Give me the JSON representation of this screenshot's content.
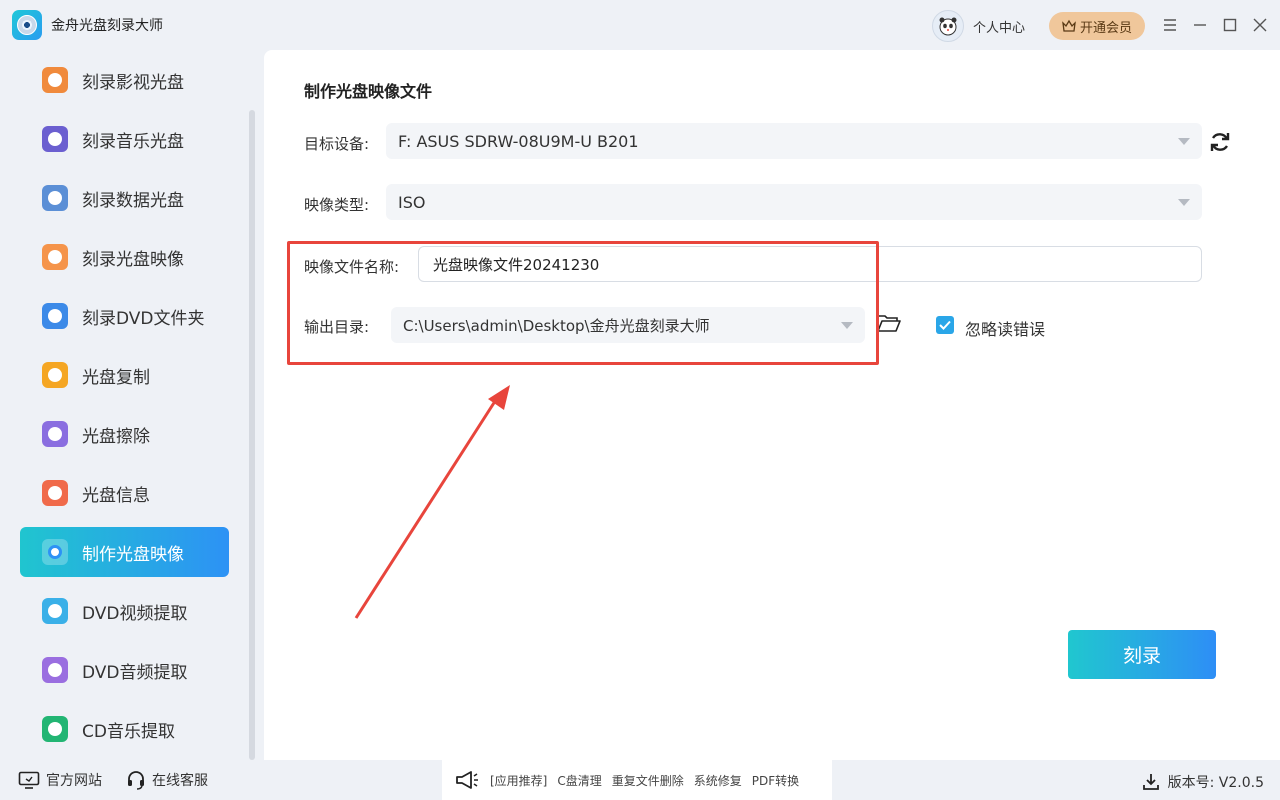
{
  "app": {
    "title": "金舟光盘刻录大师",
    "user_center": "个人中心",
    "vip_button": "开通会员"
  },
  "sidebar": {
    "items": [
      {
        "label": "刻录影视光盘",
        "icon": "video-disc-icon",
        "color": "#f08a3c"
      },
      {
        "label": "刻录音乐光盘",
        "icon": "music-disc-icon",
        "color": "#6b5fd0"
      },
      {
        "label": "刻录数据光盘",
        "icon": "data-disc-icon",
        "color": "#5b8fd6"
      },
      {
        "label": "刻录光盘映像",
        "icon": "image-disc-icon",
        "color": "#f5944a"
      },
      {
        "label": "刻录DVD文件夹",
        "icon": "dvd-folder-icon",
        "color": "#3c8ae8"
      },
      {
        "label": "光盘复制",
        "icon": "copy-disc-icon",
        "color": "#f5a623"
      },
      {
        "label": "光盘擦除",
        "icon": "erase-disc-icon",
        "color": "#8a6ee0"
      },
      {
        "label": "光盘信息",
        "icon": "info-disc-icon",
        "color": "#f06a4a"
      },
      {
        "label": "制作光盘映像",
        "icon": "make-image-icon",
        "color": "#ffffff",
        "active": true
      },
      {
        "label": "DVD视频提取",
        "icon": "dvd-video-extract-icon",
        "color": "#3ab0e8"
      },
      {
        "label": "DVD音频提取",
        "icon": "dvd-audio-extract-icon",
        "color": "#9a6ee0"
      },
      {
        "label": "CD音乐提取",
        "icon": "cd-music-extract-icon",
        "color": "#22b573"
      }
    ]
  },
  "main": {
    "title": "制作光盘映像文件",
    "target_device_label": "目标设备:",
    "target_device_value": "F: ASUS SDRW-08U9M-U B201",
    "image_type_label": "映像类型:",
    "image_type_value": "ISO",
    "image_name_label": "映像文件名称:",
    "image_name_value": "光盘映像文件20241230",
    "output_dir_label": "输出目录:",
    "output_dir_value": "C:\\Users\\admin\\Desktop\\金舟光盘刻录大师",
    "ignore_errors_label": "忽略读错误",
    "ignore_errors_checked": true,
    "burn_button": "刻录"
  },
  "footer": {
    "website": "官方网站",
    "support": "在线客服",
    "recommend_tag": "[应用推荐]",
    "links": [
      "C盘清理",
      "重复文件删除",
      "系统修复",
      "PDF转换"
    ],
    "version": "版本号: V2.0.5"
  },
  "colors": {
    "accent_start": "#20c5cf",
    "accent_end": "#2d92f5",
    "annotation_red": "#e8453c",
    "vip_gold": "#f0c79b"
  }
}
